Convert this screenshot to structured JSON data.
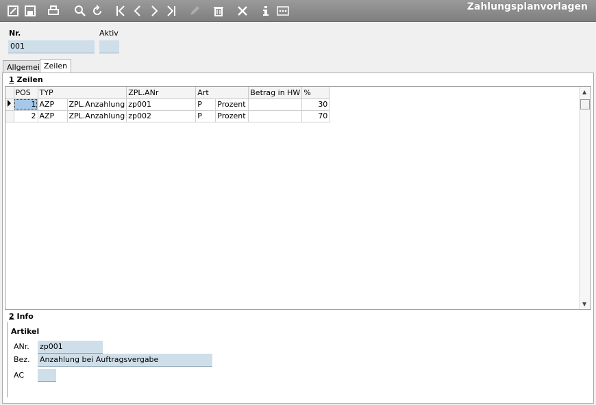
{
  "window": {
    "title": "Zahlungsplanvorlagen"
  },
  "toolbar": {
    "buttons": [
      "edit-icon",
      "save-icon",
      "print-icon",
      "search-icon",
      "refresh-icon",
      "first-record-icon",
      "previous-record-icon",
      "next-record-icon",
      "last-record-icon",
      "pencil-icon",
      "delete-icon",
      "close-icon",
      "info-icon",
      "more-icon"
    ]
  },
  "header": {
    "nr_label": "Nr.",
    "nr_value": "001",
    "aktiv_label": "Aktiv",
    "aktiv_value": ""
  },
  "tabs": [
    {
      "label": "Allgemein",
      "active": false
    },
    {
      "label": "Zeilen",
      "active": true
    }
  ],
  "zeilen": {
    "group_number": "1",
    "group_title": " Zeilen",
    "columns": [
      "POS",
      "TYP",
      "ZPL.ANr",
      "Art",
      "Betrag in HW",
      "%"
    ],
    "rows": [
      {
        "pos": "1",
        "typ": "AZP",
        "typ_name": "ZPL.Anzahlung",
        "anr": "zp001",
        "art": "P",
        "art_name": "Prozent",
        "betrag": "",
        "percent": "30"
      },
      {
        "pos": "2",
        "typ": "AZP",
        "typ_name": "ZPL.Anzahlung",
        "anr": "zp002",
        "art": "P",
        "art_name": "Prozent",
        "betrag": "",
        "percent": "70"
      }
    ]
  },
  "info": {
    "group_number": "2",
    "group_title": " Info",
    "artikel_title": "Artikel",
    "anr_label": "ANr.",
    "anr_value": "zp001",
    "bez_label": "Bez.",
    "bez_value": "Anzahlung bei Auftragsvergabe",
    "ac_label": "AC",
    "ac_value": ""
  },
  "colors": {
    "toolbar": "#8a8a8a",
    "field": "#cfdfea",
    "selection": "#a6c8ea"
  }
}
